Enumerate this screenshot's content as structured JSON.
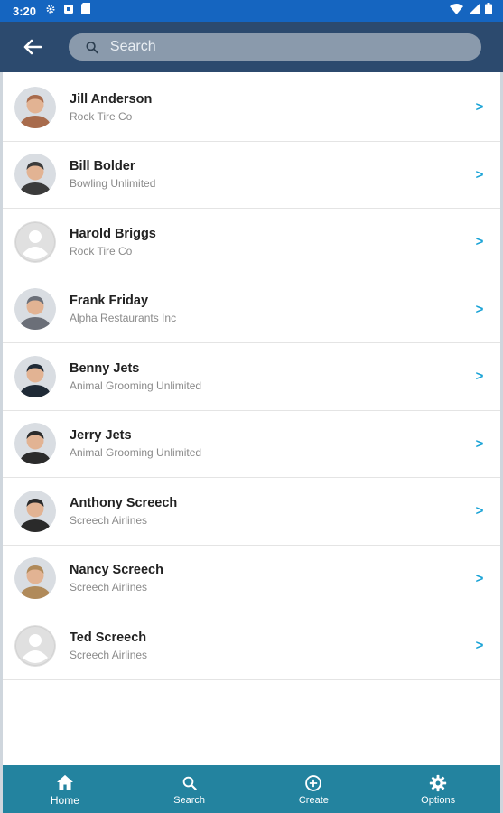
{
  "status_bar": {
    "time": "3:20",
    "left_icons": [
      "settings-icon",
      "notification-icon",
      "sim-icon"
    ],
    "right_icons": [
      "wifi-icon",
      "signal-icon",
      "battery-icon"
    ]
  },
  "app_bar": {
    "back_icon": "arrow-left-icon",
    "search_placeholder": "Search",
    "search_value": ""
  },
  "contacts": [
    {
      "name": "Jill Anderson",
      "company": "Rock Tire Co",
      "avatar": "photo",
      "avatar_color": "#a86b4c"
    },
    {
      "name": "Bill Bolder",
      "company": "Bowling Unlimited",
      "avatar": "photo",
      "avatar_color": "#3b3b3b"
    },
    {
      "name": "Harold Briggs",
      "company": "Rock Tire Co",
      "avatar": "placeholder",
      "avatar_color": "#e0e0e0"
    },
    {
      "name": "Frank Friday",
      "company": "Alpha Restaurants Inc",
      "avatar": "photo",
      "avatar_color": "#6b6f78"
    },
    {
      "name": "Benny Jets",
      "company": "Animal Grooming Unlimited",
      "avatar": "photo",
      "avatar_color": "#1f2a36"
    },
    {
      "name": "Jerry Jets",
      "company": "Animal Grooming Unlimited",
      "avatar": "photo",
      "avatar_color": "#2b2b2b"
    },
    {
      "name": "Anthony Screech",
      "company": "Screech Airlines",
      "avatar": "photo",
      "avatar_color": "#2a2a2a"
    },
    {
      "name": "Nancy Screech",
      "company": "Screech Airlines",
      "avatar": "photo",
      "avatar_color": "#b08a5a"
    },
    {
      "name": "Ted Screech",
      "company": "Screech Airlines",
      "avatar": "placeholder",
      "avatar_color": "#e0e0e0"
    }
  ],
  "chevron": ">",
  "bottom_nav": [
    {
      "label": "Home",
      "icon": "home-icon",
      "active": true
    },
    {
      "label": "Search",
      "icon": "search-icon",
      "active": false
    },
    {
      "label": "Create",
      "icon": "add-circle-icon",
      "active": false
    },
    {
      "label": "Options",
      "icon": "gear-icon",
      "active": false
    }
  ],
  "colors": {
    "status_bar": "#1565c0",
    "app_bar": "#2c4a6e",
    "search_box": "#8a9aac",
    "bottom_nav": "#23839f",
    "chevron": "#1aa3d6"
  }
}
